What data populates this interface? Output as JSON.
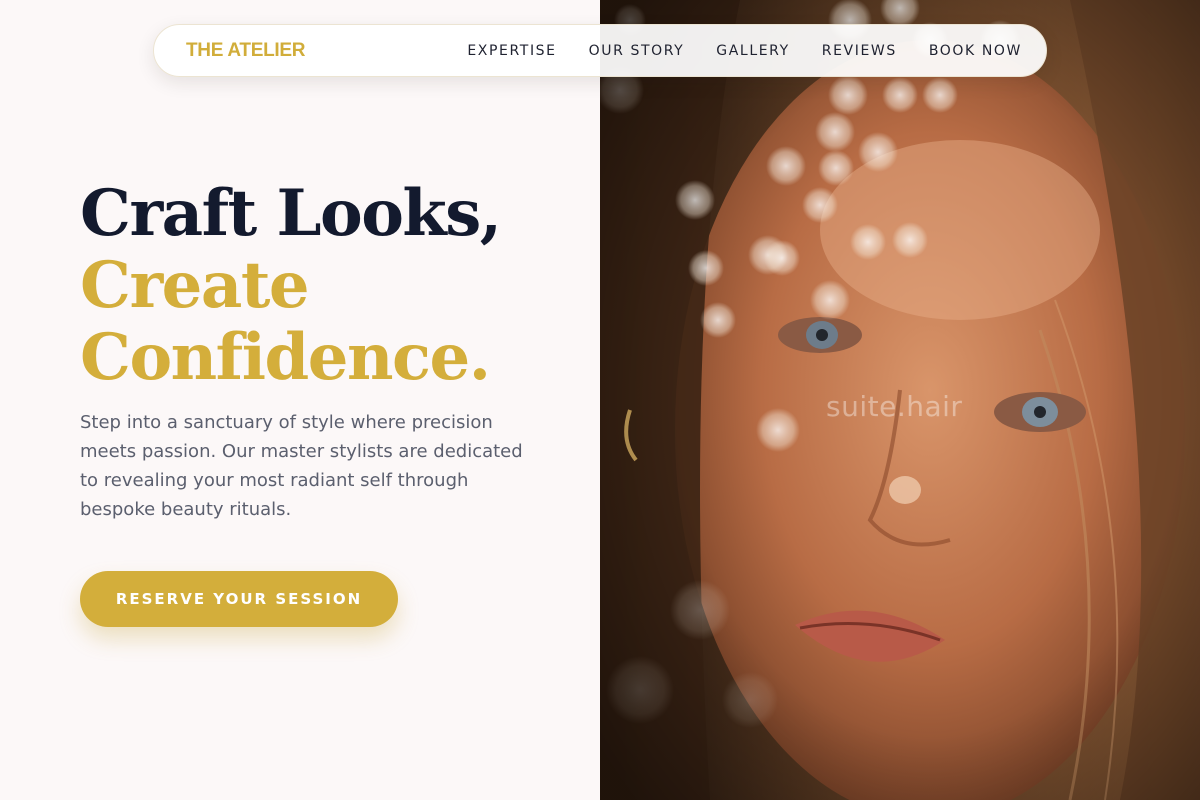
{
  "nav": {
    "brand": "THE ATELIER",
    "links": [
      {
        "label": "EXPERTISE"
      },
      {
        "label": "OUR STORY"
      },
      {
        "label": "GALLERY"
      },
      {
        "label": "REVIEWS"
      },
      {
        "label": "BOOK NOW"
      }
    ]
  },
  "hero": {
    "headline_line1": "Craft Looks,",
    "headline_line2": "Create",
    "headline_line3": "Confidence.",
    "description": "Step into a sanctuary of style where precision meets passion. Our master stylists are dedicated to revealing your most radiant self through bespoke beauty rituals.",
    "cta_label": "RESERVE YOUR SESSION"
  },
  "image": {
    "watermark": "suite.hair"
  },
  "colors": {
    "accent_gold": "#d3ae3b",
    "headline_dark": "#131a2e",
    "body_text": "#5b5f6e",
    "page_background": "#fcf8f8"
  }
}
